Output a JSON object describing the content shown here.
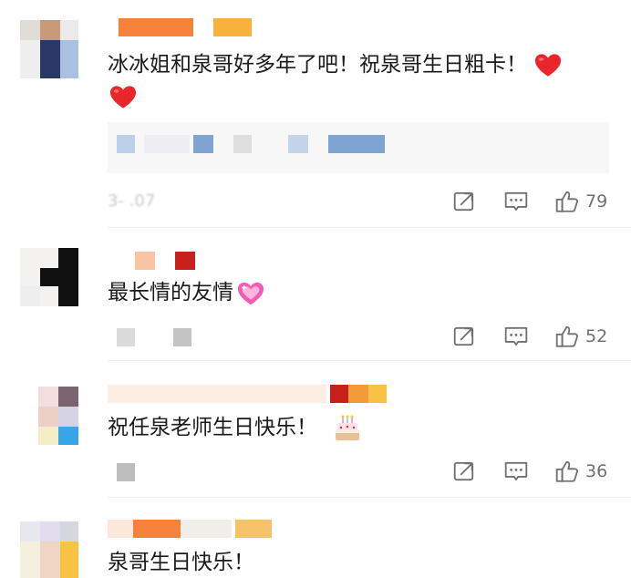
{
  "comments": [
    {
      "text": "冰冰姐和泉哥好多年了吧！祝泉哥生日粗卡！",
      "likes": "79",
      "date": "3-    .07"
    },
    {
      "text": "最长情的友情",
      "likes": "52"
    },
    {
      "text": "祝任泉老师生日快乐！",
      "likes": "36"
    },
    {
      "text": "泉哥生日快乐！"
    }
  ],
  "icons": {
    "forward": "share-forward-icon",
    "comment": "comment-bubble-icon",
    "like": "thumbs-up-icon",
    "heart": "red-heart-emoji",
    "sparkle_heart": "pink-sparkle-heart-emoji",
    "cake": "birthday-cake-emoji"
  },
  "colors": {
    "heart": "#e8262c",
    "pink_heart": "#f45ab2",
    "action_gray": "#707070"
  }
}
